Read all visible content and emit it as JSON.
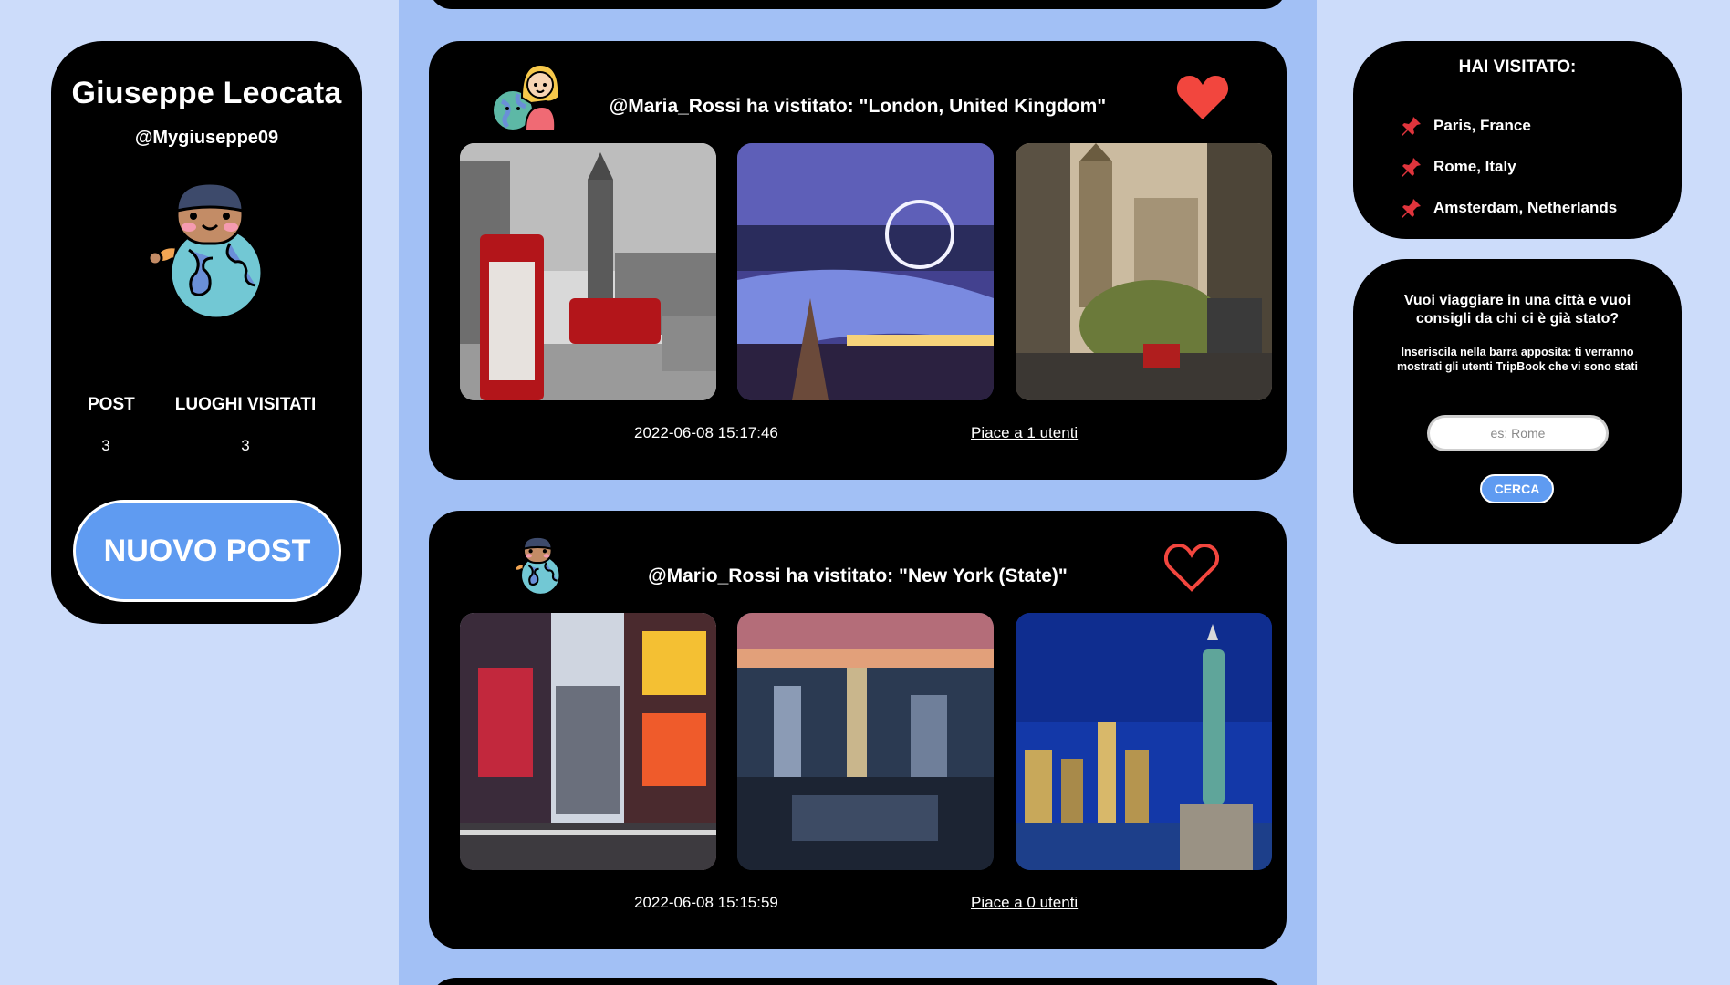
{
  "profile": {
    "name": "Giuseppe Leocata",
    "handle": "@Mygiuseppe09",
    "stats": [
      {
        "label": "POST",
        "value": "3"
      },
      {
        "label": "LUOGHI VISITATI",
        "value": "3"
      }
    ],
    "new_post_label": "NUOVO POST"
  },
  "posts": [
    {
      "title": "@Maria_Rossi ha vistitato: \"London, United Kingdom\"",
      "date": "2022-06-08 15:17:46",
      "likes": "Piace a 1 utenti",
      "liked": true,
      "avatar": "girl-globe-avatar-icon"
    },
    {
      "title": "@Mario_Rossi ha vistitato: \"New York (State)\"",
      "date": "2022-06-08 15:15:59",
      "likes": "Piace a 0 utenti",
      "liked": false,
      "avatar": "boy-globe-avatar-icon"
    }
  ],
  "visited": {
    "title": "HAI VISITATO:",
    "places": [
      "Paris, France",
      "Rome, Italy",
      "Amsterdam, Netherlands"
    ]
  },
  "search": {
    "question": "Vuoi viaggiare in una città e vuoi consigli da chi ci è già stato?",
    "hint": "Inseriscila nella barra apposita: ti verranno mostrati gli utenti TripBook che vi sono stati",
    "placeholder": "es: Rome",
    "button": "CERCA"
  },
  "colors": {
    "page_bg": "#ccdcfa",
    "feed_bg": "#a2c0f5",
    "card_bg": "#000000",
    "accent": "#5f9bf1",
    "heart": "#f2463e"
  }
}
